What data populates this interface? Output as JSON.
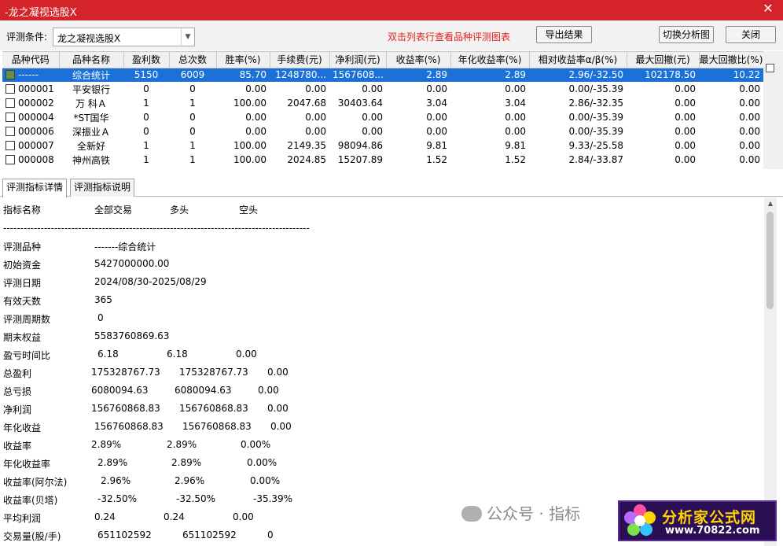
{
  "window": {
    "title": "-龙之凝视选股X"
  },
  "toolbar": {
    "criteria_label": "评测条件:",
    "criteria_value": "龙之凝视选股X",
    "hint": "双击列表行查看品种评测图表",
    "export_label": "导出结果",
    "switch_label": "切换分析图",
    "close_label": "关闭"
  },
  "grid": {
    "columns": [
      "品种代码",
      "品种名称",
      "盈利数",
      "总次数",
      "胜率(%)",
      "手续费(元)",
      "净利润(元)",
      "收益率(%)",
      "年化收益率(%)",
      "相对收益率α/β(%)",
      "最大回撤(元)",
      "最大回撤比(%)"
    ],
    "rows": [
      [
        "------",
        "综合统计",
        "5150",
        "6009",
        "85.70",
        "1248780...",
        "1567608...",
        "2.89",
        "2.89",
        "2.96/-32.50",
        "102178.50",
        "10.22"
      ],
      [
        "000001",
        "平安银行",
        "0",
        "0",
        "0.00",
        "0.00",
        "0.00",
        "0.00",
        "0.00",
        "0.00/-35.39",
        "0.00",
        "0.00"
      ],
      [
        "000002",
        "万 科Ａ",
        "1",
        "1",
        "100.00",
        "2047.68",
        "30403.64",
        "3.04",
        "3.04",
        "2.86/-32.35",
        "0.00",
        "0.00"
      ],
      [
        "000004",
        "*ST国华",
        "0",
        "0",
        "0.00",
        "0.00",
        "0.00",
        "0.00",
        "0.00",
        "0.00/-35.39",
        "0.00",
        "0.00"
      ],
      [
        "000006",
        "深振业Ａ",
        "0",
        "0",
        "0.00",
        "0.00",
        "0.00",
        "0.00",
        "0.00",
        "0.00/-35.39",
        "0.00",
        "0.00"
      ],
      [
        "000007",
        "全新好",
        "1",
        "1",
        "100.00",
        "2149.35",
        "98094.86",
        "9.81",
        "9.81",
        "9.33/-25.58",
        "0.00",
        "0.00"
      ],
      [
        "000008",
        "神州高铁",
        "1",
        "1",
        "100.00",
        "2024.85",
        "15207.89",
        "1.52",
        "1.52",
        "2.84/-33.87",
        "0.00",
        "0.00"
      ]
    ]
  },
  "tabs": [
    "评测指标详情",
    "评测指标说明"
  ],
  "detail": {
    "header": [
      "指标名称",
      "全部交易",
      "多头",
      "空头"
    ],
    "separator": "------------------------------------------------------------------------------------------",
    "rows": [
      {
        "name": "评测品种",
        "v1": "-------综合统计",
        "v2": "",
        "v3": ""
      },
      {
        "name": "初始资金",
        "v1": "5427000000.00",
        "v2": "",
        "v3": ""
      },
      {
        "name": "评测日期",
        "v1": "2024/08/30-2025/08/29",
        "v2": "",
        "v3": ""
      },
      {
        "name": "有效天数",
        "v1": "365",
        "v2": "",
        "v3": ""
      },
      {
        "name": "评测周期数",
        "v1": "0",
        "v2": "",
        "v3": ""
      },
      {
        "name": "期末权益",
        "v1": "5583760869.63",
        "v2": "",
        "v3": ""
      },
      {
        "name": "盈亏时间比",
        "v1": "6.18",
        "v2": "6.18",
        "v3": "0.00"
      },
      {
        "name": "总盈利",
        "v1": "175328767.73",
        "v2": "175328767.73",
        "v3": "0.00"
      },
      {
        "name": "总亏损",
        "v1": "6080094.63",
        "v2": "6080094.63",
        "v3": "0.00"
      },
      {
        "name": "净利润",
        "v1": "156760868.83",
        "v2": "156760868.83",
        "v3": "0.00"
      },
      {
        "name": "年化收益",
        "v1": "156760868.83",
        "v2": "156760868.83",
        "v3": "0.00"
      },
      {
        "name": "收益率",
        "v1": "2.89%",
        "v2": "2.89%",
        "v3": "0.00%"
      },
      {
        "name": "年化收益率",
        "v1": "2.89%",
        "v2": "2.89%",
        "v3": "0.00%"
      },
      {
        "name": "收益率(阿尔法)",
        "v1": "2.96%",
        "v2": "2.96%",
        "v3": "0.00%"
      },
      {
        "name": "收益率(贝塔)",
        "v1": "-32.50%",
        "v2": "-32.50%",
        "v3": "-35.39%"
      },
      {
        "name": "平均利润",
        "v1": "0.24",
        "v2": "0.24",
        "v3": "0.00"
      },
      {
        "name": "交易量(股/手)",
        "v1": "651102592",
        "v2": "651102592",
        "v3": "0"
      }
    ]
  },
  "watermark": {
    "wechat_text": "公众号 · 指标",
    "logo_line1": "分析家公式网",
    "logo_line2": "www.70822.com"
  },
  "colors": {
    "titlebar": "#d4242a",
    "selection": "#1b71d8",
    "hint": "#e0211b"
  }
}
